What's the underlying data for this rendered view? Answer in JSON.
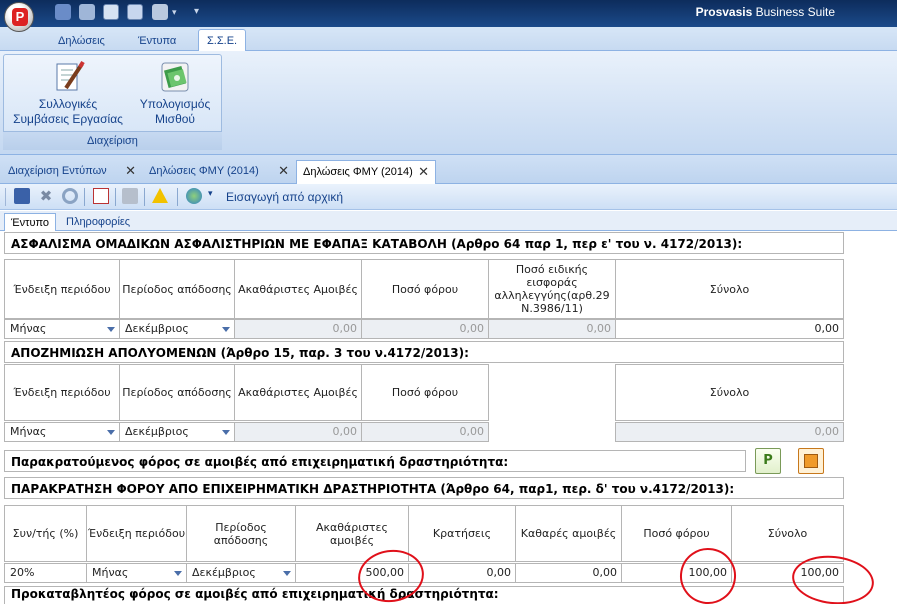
{
  "app": {
    "title_brand": "Prosvasis",
    "title_rest": " Business Suite"
  },
  "ribbon": {
    "tabs": [
      "Δηλώσεις",
      "Έντυπα",
      "Σ.Σ.Ε."
    ],
    "group": {
      "label": "Διαχείριση",
      "buttons": [
        {
          "line1": "Συλλογικές",
          "line2": "Συμβάσεις Εργασίας",
          "icon": "contract-pen-icon"
        },
        {
          "line1": "Υπολογισμός",
          "line2": "Μισθού",
          "icon": "money-calculator-icon"
        }
      ]
    }
  },
  "doc_tabs": [
    "Διαχείριση Εντύπων",
    "Δηλώσεις ΦΜΥ (2014)",
    "Δηλώσεις ΦΜΥ (2014)"
  ],
  "toolbar": {
    "import_label": "Εισαγωγή από αρχική"
  },
  "sub_tabs": [
    "Έντυπο",
    "Πληροφορίες"
  ],
  "section1": {
    "title": "ΑΣΦΑΛΙΣΜΑ ΟΜΑΔΙΚΩΝ ΑΣΦΑΛΙΣΤΗΡΙΩΝ ΜΕ ΕΦΑΠΑΞ ΚΑΤΑΒΟΛΗ (Αρθρο 64 παρ 1, περ ε' του ν. 4172/2013):",
    "headers": [
      "Ένδειξη περιόδου",
      "Περίοδος απόδοσης",
      "Ακαθάριστες Αμοιβές",
      "Ποσό φόρου",
      "Ποσό ειδικής εισφοράς αλληλεγγύης(αρθ.29 N.3986/11)",
      "Σύνολο"
    ],
    "row": {
      "period_indication": "Μήνας",
      "period": "Δεκέμβριος",
      "gross": "0,00",
      "tax": "0,00",
      "solidarity": "0,00",
      "total": "0,00"
    }
  },
  "section2": {
    "title": "ΑΠΟΖΗΜΙΩΣΗ ΑΠΟΛΥΟΜΕΝΩΝ (Άρθρο 15, παρ. 3 του ν.4172/2013):",
    "headers": [
      "Ένδειξη περιόδου",
      "Περίοδος απόδοσης",
      "Ακαθάριστες Αμοιβές",
      "Ποσό φόρου",
      "Σύνολο"
    ],
    "row": {
      "period_indication": "Μήνας",
      "period": "Δεκέμβριος",
      "gross": "0,00",
      "tax": "0,00",
      "total": "0,00"
    }
  },
  "section3": {
    "title": "Παρακρατούμενος φόρος σε αμοιβές από επιχειρηματική δραστηριότητα:"
  },
  "section4": {
    "title": "ΠΑΡΑΚΡΑΤΗΣΗ ΦΟΡΟΥ ΑΠΟ ΕΠΙΧΕΙΡΗΜΑΤΙΚΗ ΔΡΑΣΤΗΡΙΟΤΗΤΑ (Άρθρο 64, παρ1, περ. δ' του ν.4172/2013):",
    "headers": [
      "Συν/τής (%)",
      "Ένδειξη περιόδου",
      "Περίοδος απόδοσης",
      "Ακαθάριστες αμοιβές",
      "Κρατήσεις",
      "Καθαρές αμοιβές",
      "Ποσό φόρου",
      "Σύνολο"
    ],
    "row": {
      "rate": "20%",
      "period_indication": "Μήνας",
      "period": "Δεκέμβριος",
      "gross": "500,00",
      "deductions": "0,00",
      "net": "0,00",
      "tax": "100,00",
      "total": "100,00"
    }
  },
  "section5": {
    "title": "Προκαταβλητέος φόρος σε αμοιβές από επιχειρηματική δραστηριότητα:"
  },
  "colors": {
    "annotation": "#e0101a",
    "accent": "#15428b"
  }
}
